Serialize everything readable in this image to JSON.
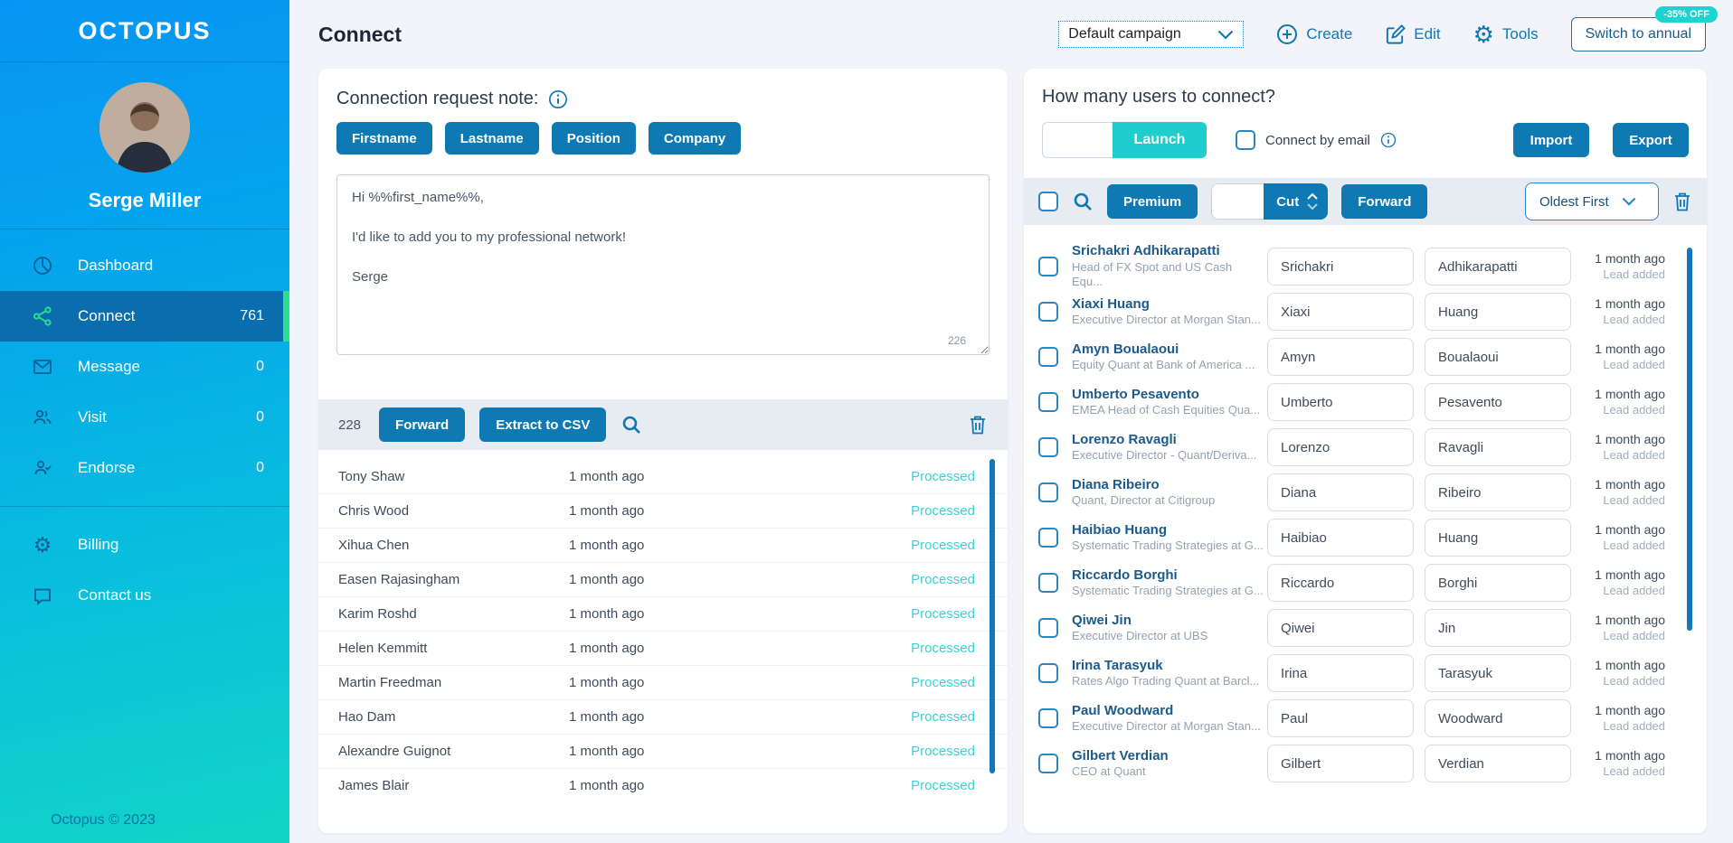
{
  "sidebar": {
    "logo": "OCTOPUS",
    "user_name": "Serge Miller",
    "nav": [
      {
        "label": "Dashboard",
        "count": ""
      },
      {
        "label": "Connect",
        "count": "761"
      },
      {
        "label": "Message",
        "count": "0"
      },
      {
        "label": "Visit",
        "count": "0"
      },
      {
        "label": "Endorse",
        "count": "0"
      }
    ],
    "secondary_nav": [
      {
        "label": "Billing"
      },
      {
        "label": "Contact us"
      }
    ],
    "footer": "Octopus © 2023"
  },
  "header": {
    "title": "Connect",
    "campaign_select_value": "Default campaign",
    "create_label": "Create",
    "edit_label": "Edit",
    "tools_label": "Tools",
    "switch_annual_label": "Switch to annual",
    "discount_badge": "-35% OFF"
  },
  "note_panel": {
    "title": "Connection request note:",
    "tags": [
      "Firstname",
      "Lastname",
      "Position",
      "Company"
    ],
    "message": "Hi %%first_name%%,\n\nI'd like to add you to my professional network!\n\nSerge",
    "char_count": "226"
  },
  "processed_panel": {
    "count": "228",
    "forward_label": "Forward",
    "extract_label": "Extract to CSV",
    "rows": [
      {
        "name": "Tony Shaw",
        "time": "1 month ago",
        "status": "Processed"
      },
      {
        "name": "Chris Wood",
        "time": "1 month ago",
        "status": "Processed"
      },
      {
        "name": "Xihua Chen",
        "time": "1 month ago",
        "status": "Processed"
      },
      {
        "name": "Easen Rajasingham",
        "time": "1 month ago",
        "status": "Processed"
      },
      {
        "name": "Karim Roshd",
        "time": "1 month ago",
        "status": "Processed"
      },
      {
        "name": "Helen Kemmitt",
        "time": "1 month ago",
        "status": "Processed"
      },
      {
        "name": "Martin Freedman",
        "time": "1 month ago",
        "status": "Processed"
      },
      {
        "name": "Hao Dam",
        "time": "1 month ago",
        "status": "Processed"
      },
      {
        "name": "Alexandre Guignot",
        "time": "1 month ago",
        "status": "Processed"
      },
      {
        "name": "James Blair",
        "time": "1 month ago",
        "status": "Processed"
      }
    ]
  },
  "connect_panel": {
    "title": "How many users to connect?",
    "users_input_value": "",
    "launch_label": "Launch",
    "connect_by_email_label": "Connect by email",
    "import_label": "Import",
    "export_label": "Export",
    "toolbar": {
      "premium_label": "Premium",
      "cut_input_value": "",
      "cut_label": "Cut",
      "forward_label": "Forward",
      "sort_value": "Oldest First"
    },
    "rows": [
      {
        "name": "Srichakri Adhikarapatti",
        "subtitle": "Head of FX Spot and US Cash Equ...",
        "first": "Srichakri",
        "last": "Adhikarapatti",
        "time": "1 month ago",
        "status": "Lead added"
      },
      {
        "name": "Xiaxi Huang",
        "subtitle": "Executive Director at Morgan Stan...",
        "first": "Xiaxi",
        "last": "Huang",
        "time": "1 month ago",
        "status": "Lead added"
      },
      {
        "name": "Amyn Boualaoui",
        "subtitle": "Equity Quant at Bank of America ...",
        "first": "Amyn",
        "last": "Boualaoui",
        "time": "1 month ago",
        "status": "Lead added"
      },
      {
        "name": "Umberto Pesavento",
        "subtitle": "EMEA Head of Cash Equities Qua...",
        "first": "Umberto",
        "last": "Pesavento",
        "time": "1 month ago",
        "status": "Lead added"
      },
      {
        "name": "Lorenzo Ravagli",
        "subtitle": "Executive Director - Quant/Deriva...",
        "first": "Lorenzo",
        "last": "Ravagli",
        "time": "1 month ago",
        "status": "Lead added"
      },
      {
        "name": "Diana Ribeiro",
        "subtitle": "Quant, Director at Citigroup",
        "first": "Diana",
        "last": "Ribeiro",
        "time": "1 month ago",
        "status": "Lead added"
      },
      {
        "name": "Haibiao Huang",
        "subtitle": "Systematic Trading Strategies at G...",
        "first": "Haibiao",
        "last": "Huang",
        "time": "1 month ago",
        "status": "Lead added"
      },
      {
        "name": "Riccardo Borghi",
        "subtitle": "Systematic Trading Strategies at G...",
        "first": "Riccardo",
        "last": "Borghi",
        "time": "1 month ago",
        "status": "Lead added"
      },
      {
        "name": "Qiwei Jin",
        "subtitle": "Executive Director at UBS",
        "first": "Qiwei",
        "last": "Jin",
        "time": "1 month ago",
        "status": "Lead added"
      },
      {
        "name": "Irina Tarasyuk",
        "subtitle": "Rates Algo Trading Quant at Barcl...",
        "first": "Irina",
        "last": "Tarasyuk",
        "time": "1 month ago",
        "status": "Lead added"
      },
      {
        "name": "Paul Woodward",
        "subtitle": "Executive Director at Morgan Stan...",
        "first": "Paul",
        "last": "Woodward",
        "time": "1 month ago",
        "status": "Lead added"
      },
      {
        "name": "Gilbert Verdian",
        "subtitle": "CEO at Quant",
        "first": "Gilbert",
        "last": "Verdian",
        "time": "1 month ago",
        "status": "Lead added"
      }
    ]
  },
  "icons": {
    "info": "circle-i",
    "search": "magnifier",
    "trash": "trash-can",
    "gear": "cog",
    "create": "circle-plus",
    "edit": "pencil-square",
    "chevron": "chevron-down",
    "dashboard": "pie-chart",
    "connect": "share-nodes",
    "message": "envelope",
    "visit": "two-people",
    "endorse": "person-check",
    "contact": "chat-bubble"
  },
  "colors": {
    "brand_blue": "#0e79b2",
    "teal_accent": "#1fcdcd",
    "green_accent": "#27e08e",
    "processed_text": "#38d3da",
    "sidebar_top": "#0795f3",
    "sidebar_bottom": "#12d5c6",
    "active_nav_bg": "#0a6dad"
  }
}
